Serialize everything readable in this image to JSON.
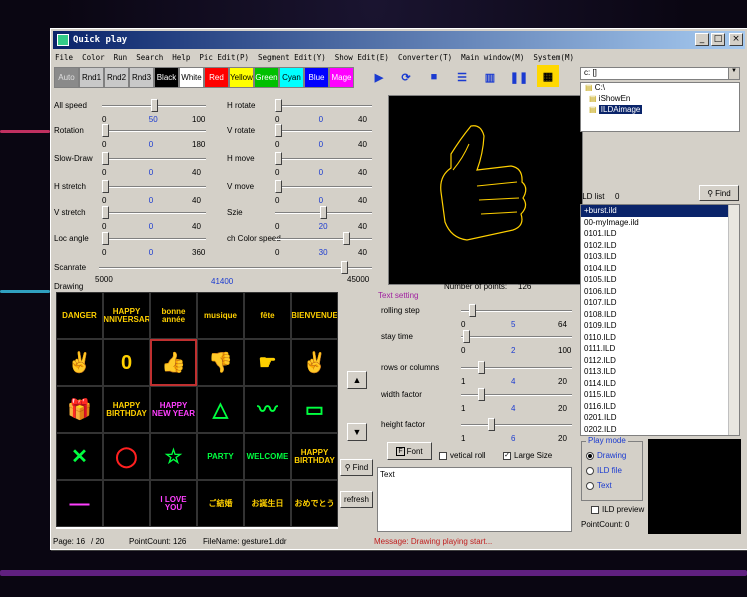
{
  "window": {
    "title": "Quick play",
    "min": "_",
    "max": "□",
    "close": "×"
  },
  "menu": [
    "File",
    "Color",
    "Run",
    "Search",
    "Help",
    "Pic Edit(P)",
    "Segment Edit(Y)",
    "Show Edit(E)",
    "Converter(T)",
    "Main window(M)",
    "System(M)"
  ],
  "colors": [
    {
      "label": "Auto",
      "bg": "#8a8a8a",
      "fg": "#e0e0e0"
    },
    {
      "label": "Rnd1",
      "bg": "#c8c8c8",
      "fg": "#000"
    },
    {
      "label": "Rnd2",
      "bg": "#c8c8c8",
      "fg": "#000"
    },
    {
      "label": "Rnd3",
      "bg": "#c8c8c8",
      "fg": "#000"
    },
    {
      "label": "Black",
      "bg": "#000000",
      "fg": "#ffffff"
    },
    {
      "label": "White",
      "bg": "#ffffff",
      "fg": "#000"
    },
    {
      "label": "Red",
      "bg": "#ff0000",
      "fg": "#ffffff"
    },
    {
      "label": "Yellow",
      "bg": "#ffff00",
      "fg": "#000"
    },
    {
      "label": "Green",
      "bg": "#00c000",
      "fg": "#ffffff"
    },
    {
      "label": "Cyan",
      "bg": "#00ffff",
      "fg": "#000"
    },
    {
      "label": "Blue",
      "bg": "#0000ff",
      "fg": "#ffffff"
    },
    {
      "label": "Mage",
      "bg": "#ff00ff",
      "fg": "#ffffff"
    }
  ],
  "toolbar_icons": [
    "play-icon",
    "loop-icon",
    "stop-icon",
    "list-icon",
    "grid-icon",
    "pause-icon",
    "calendar-icon"
  ],
  "toolbar_glyphs": [
    "▶",
    "⟳",
    "■",
    "☰",
    "▥",
    "❚❚",
    "▦"
  ],
  "params": {
    "all_speed": {
      "label": "All speed",
      "min": "0",
      "val": "50",
      "max": "100",
      "frac": 0.5
    },
    "rotation": {
      "label": "Rotation",
      "min": "0",
      "val": "0",
      "max": "180",
      "frac": 0
    },
    "slow_draw": {
      "label": "Slow-Draw",
      "min": "0",
      "val": "0",
      "max": "40",
      "frac": 0
    },
    "h_stretch": {
      "label": "H stretch",
      "min": "0",
      "val": "0",
      "max": "40",
      "frac": 0
    },
    "v_stretch": {
      "label": "V stretch",
      "min": "0",
      "val": "0",
      "max": "40",
      "frac": 0
    },
    "loc_angle": {
      "label": "Loc angle",
      "min": "0",
      "val": "0",
      "max": "360",
      "frac": 0
    },
    "h_rotate": {
      "label": "H rotate",
      "min": "0",
      "val": "0",
      "max": "40",
      "frac": 0
    },
    "v_rotate": {
      "label": "V rotate",
      "min": "0",
      "val": "0",
      "max": "40",
      "frac": 0
    },
    "h_move": {
      "label": "H move",
      "min": "0",
      "val": "0",
      "max": "40",
      "frac": 0
    },
    "v_move": {
      "label": "V move",
      "min": "0",
      "val": "0",
      "max": "40",
      "frac": 0
    },
    "size": {
      "label": "Szie",
      "min": "0",
      "val": "20",
      "max": "40",
      "frac": 0.5
    },
    "ch_color_speed": {
      "label": "ch Color speed",
      "min": "0",
      "val": "30",
      "max": "40",
      "frac": 0.75
    },
    "scanrate": {
      "label": "Scanrate",
      "min": "5000",
      "val": "41400",
      "max": "45000",
      "frac": 0.91
    }
  },
  "drawing_label": "Drawing",
  "number_of_points_label": "Number of points:",
  "number_of_points": "126",
  "text_setting_label": "Text setting",
  "text_params": {
    "rolling_step": {
      "label": "rolling step",
      "min": "0",
      "val": "5",
      "max": "64",
      "frac": 0.08
    },
    "stay_time": {
      "label": "stay time",
      "min": "0",
      "val": "2",
      "max": "100",
      "frac": 0.02
    },
    "rows": {
      "label": "rows or columns",
      "min": "1",
      "val": "4",
      "max": "20",
      "frac": 0.16
    },
    "width_factor": {
      "label": "width factor",
      "min": "1",
      "val": "4",
      "max": "20",
      "frac": 0.16
    },
    "height_factor": {
      "label": "height factor",
      "min": "1",
      "val": "6",
      "max": "20",
      "frac": 0.26
    }
  },
  "font_btn": "Font",
  "vertical_roll": "vetical roll",
  "large_size": "Large Size",
  "text_box": "Text",
  "find_btn": "Find",
  "refresh_btn": "refresh",
  "up_btn": "▲",
  "down_btn": "▼",
  "drive": "c: []",
  "tree": [
    "C:\\",
    "iShowEn",
    "ILDAimage"
  ],
  "ild_list_label": "ILD list",
  "ild_list_count": "0",
  "ild_find_btn": "Find",
  "ild_files": [
    "+burst.ild",
    "00-myImage.ild",
    "0101.ILD",
    "0102.ILD",
    "0103.ILD",
    "0104.ILD",
    "0105.ILD",
    "0106.ILD",
    "0107.ILD",
    "0108.ILD",
    "0109.ILD",
    "0110.ILD",
    "0111.ILD",
    "0112.ILD",
    "0113.ILD",
    "0114.ILD",
    "0115.ILD",
    "0116.ILD",
    "0201.ILD",
    "0202.ILD"
  ],
  "play_mode_label": "Play mode",
  "play_modes": [
    "Drawing",
    "ILD file",
    "Text"
  ],
  "ild_preview": "ILD preview",
  "point_count_right": "PointCount:  0",
  "status": {
    "page": "Page: 16",
    "pages": "/ 20",
    "points": "PointCount:  126",
    "file": "FileName:  gesture1.ddr",
    "message": "Message: Drawing playing start..."
  },
  "thumbnails": [
    {
      "t": "DANGER",
      "c": "#ffd000"
    },
    {
      "t": "HAPPY ANNIVERSARY",
      "c": "#ffd000"
    },
    {
      "t": "bonne année",
      "c": "#ffd000"
    },
    {
      "t": "musique",
      "c": "#ffd000"
    },
    {
      "t": "fête",
      "c": "#ffd000"
    },
    {
      "t": "BIENVENUE",
      "c": "#ffd000"
    },
    {
      "t": "✌",
      "c": "#ffd000"
    },
    {
      "t": "0",
      "c": "#ffd000"
    },
    {
      "t": "👍",
      "c": "#ffd000"
    },
    {
      "t": "👎",
      "c": "#ffd000"
    },
    {
      "t": "☛",
      "c": "#ffd000"
    },
    {
      "t": "✌",
      "c": "#ffd000"
    },
    {
      "t": "🎁",
      "c": "#ff40ff"
    },
    {
      "t": "HAPPY BIRTHDAY",
      "c": "#ffd000"
    },
    {
      "t": "HAPPY NEW YEAR",
      "c": "#ff40ff"
    },
    {
      "t": "△",
      "c": "#00ff40"
    },
    {
      "t": "〰",
      "c": "#00ff40"
    },
    {
      "t": "▭",
      "c": "#00ff40"
    },
    {
      "t": "✕",
      "c": "#00ff40"
    },
    {
      "t": "◯",
      "c": "#ff2020"
    },
    {
      "t": "☆",
      "c": "#00ff40"
    },
    {
      "t": "PARTY",
      "c": "#00ff40"
    },
    {
      "t": "WELCOME",
      "c": "#00ff40"
    },
    {
      "t": "HAPPY BIRTHDAY",
      "c": "#ffd000"
    },
    {
      "t": "—",
      "c": "#ff40ff"
    },
    {
      "t": "",
      "c": "#fff"
    },
    {
      "t": "I LOVE YOU",
      "c": "#ff40ff"
    },
    {
      "t": "ご結婚",
      "c": "#ffd000"
    },
    {
      "t": "お誕生日",
      "c": "#ffd000"
    },
    {
      "t": "おめでとう",
      "c": "#ffd000"
    }
  ]
}
